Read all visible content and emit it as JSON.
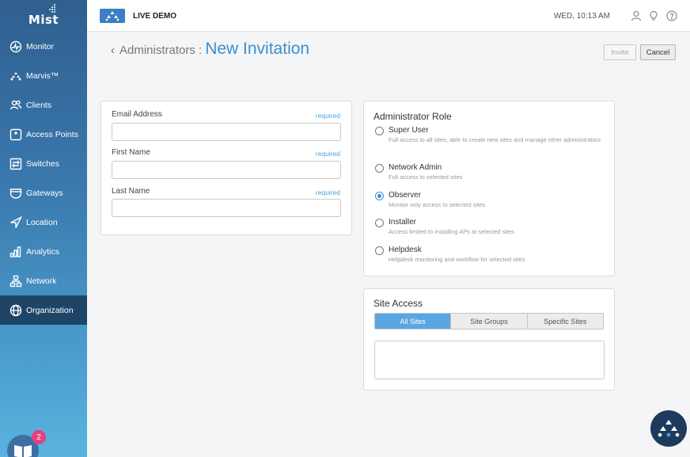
{
  "sidebar": {
    "logo": "Mist",
    "items": [
      {
        "label": "Monitor",
        "icon": "monitor-icon"
      },
      {
        "label": "Marvis™",
        "icon": "marvis-icon"
      },
      {
        "label": "Clients",
        "icon": "clients-icon"
      },
      {
        "label": "Access Points",
        "icon": "access-point-icon"
      },
      {
        "label": "Switches",
        "icon": "switch-icon"
      },
      {
        "label": "Gateways",
        "icon": "gateway-icon"
      },
      {
        "label": "Location",
        "icon": "location-icon"
      },
      {
        "label": "Analytics",
        "icon": "analytics-icon"
      },
      {
        "label": "Network",
        "icon": "network-icon"
      },
      {
        "label": "Organization",
        "icon": "globe-icon"
      }
    ],
    "active": "Organization",
    "help_badge": "2"
  },
  "topbar": {
    "demo_label": "LIVE DEMO",
    "clock": "WED, 10:13 AM"
  },
  "page": {
    "breadcrumb": "Administrators :",
    "title": "New Invitation",
    "invite_label": "Invite",
    "cancel_label": "Cancel"
  },
  "form": {
    "email_label": "Email Address",
    "first_label": "First Name",
    "last_label": "Last Name",
    "required": "required",
    "email_value": "",
    "first_value": "",
    "last_value": ""
  },
  "roles": {
    "title": "Administrator Role",
    "selected": "Observer",
    "items": [
      {
        "name": "Super User",
        "desc": "Full access to all sites, able to create new sites and manage other administrators"
      },
      {
        "name": "Network Admin",
        "desc": "Full access to selected sites"
      },
      {
        "name": "Observer",
        "desc": "Monitor only access to selected sites"
      },
      {
        "name": "Installer",
        "desc": "Access limited to installing APs at selected sites"
      },
      {
        "name": "Helpdesk",
        "desc": "Helpdesk monitoring and workflow for selected sites"
      }
    ]
  },
  "site_access": {
    "title": "Site Access",
    "tabs": [
      "All Sites",
      "Site Groups",
      "Specific Sites"
    ],
    "active": "All Sites"
  },
  "colors": {
    "accent": "#3b8fd3",
    "sidebar_active": "#1f4566",
    "badge": "#e0417f"
  }
}
